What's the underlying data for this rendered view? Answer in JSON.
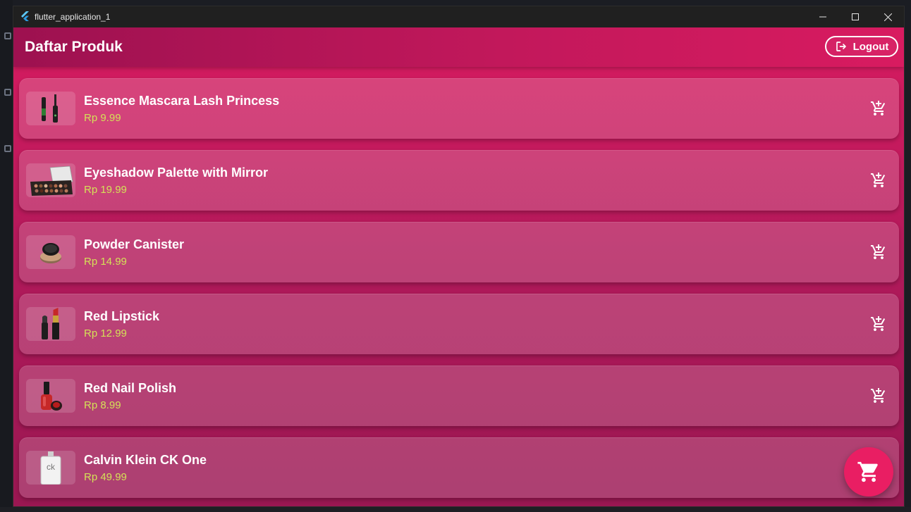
{
  "window": {
    "title": "flutter_application_1"
  },
  "appbar": {
    "title": "Daftar Produk",
    "logout_label": "Logout"
  },
  "products": [
    {
      "name": "Essence Mascara Lash Princess",
      "price": "Rp 9.99",
      "icon": "mascara"
    },
    {
      "name": "Eyeshadow Palette with Mirror",
      "price": "Rp 19.99",
      "icon": "eyeshadow-palette"
    },
    {
      "name": "Powder Canister",
      "price": "Rp 14.99",
      "icon": "powder-canister"
    },
    {
      "name": "Red Lipstick",
      "price": "Rp 12.99",
      "icon": "lipstick"
    },
    {
      "name": "Red Nail Polish",
      "price": "Rp 8.99",
      "icon": "nail-polish"
    },
    {
      "name": "Calvin Klein CK One",
      "price": "Rp 49.99",
      "icon": "perfume-bottle",
      "thumb_text": "ck"
    }
  ],
  "colors": {
    "appbar": "#c2185b",
    "background": "#d81b60",
    "price": "#d4e157",
    "fab": "#e91e63"
  }
}
